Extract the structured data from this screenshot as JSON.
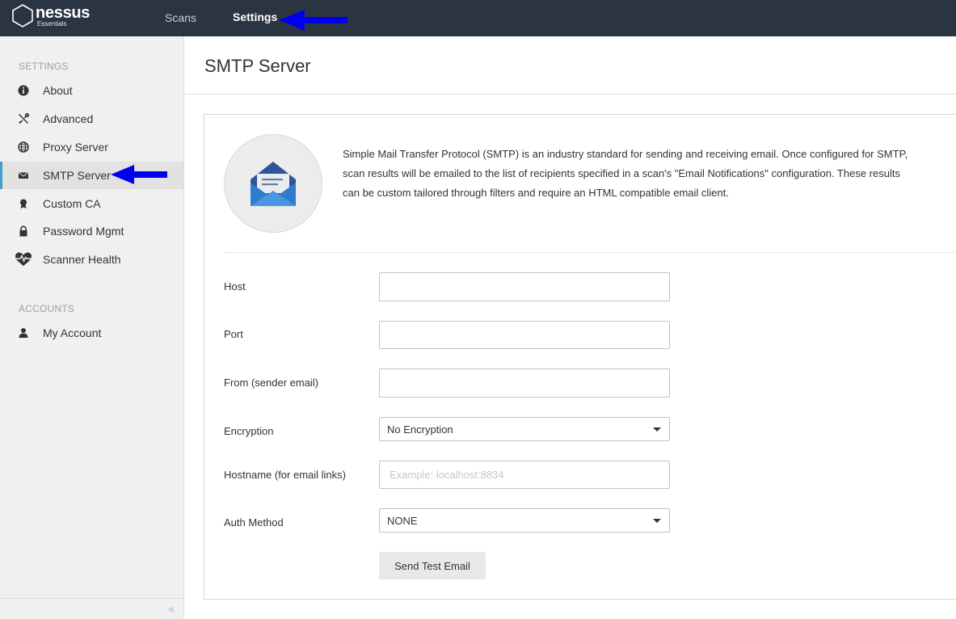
{
  "app": {
    "logo_name": "nessus",
    "logo_sub": "Essentials"
  },
  "topnav": {
    "items": [
      {
        "label": "Scans",
        "active": false
      },
      {
        "label": "Settings",
        "active": true
      }
    ]
  },
  "sidebar": {
    "settings_header": "SETTINGS",
    "settings_items": [
      {
        "label": "About",
        "icon": "info-icon"
      },
      {
        "label": "Advanced",
        "icon": "tools-icon"
      },
      {
        "label": "Proxy Server",
        "icon": "globe-icon"
      },
      {
        "label": "SMTP Server",
        "icon": "envelope-icon",
        "active": true
      },
      {
        "label": "Custom CA",
        "icon": "certificate-icon"
      },
      {
        "label": "Password Mgmt",
        "icon": "lock-icon"
      },
      {
        "label": "Scanner Health",
        "icon": "heart-pulse-icon"
      }
    ],
    "accounts_header": "ACCOUNTS",
    "accounts_items": [
      {
        "label": "My Account",
        "icon": "user-icon"
      }
    ],
    "collapse_glyph": "«"
  },
  "main": {
    "title": "SMTP Server",
    "description": "Simple Mail Transfer Protocol (SMTP) is an industry standard for sending and receiving email. Once configured for SMTP, scan results will be emailed to the list of recipients specified in a scan's \"Email Notifications\" configuration. These results can be custom tailored through filters and require an HTML compatible email client.",
    "form": {
      "host": {
        "label": "Host",
        "value": "",
        "placeholder": ""
      },
      "port": {
        "label": "Port",
        "value": "",
        "placeholder": ""
      },
      "from": {
        "label": "From (sender email)",
        "value": "",
        "placeholder": ""
      },
      "encryption": {
        "label": "Encryption",
        "value": "No Encryption"
      },
      "hostname": {
        "label": "Hostname (for email links)",
        "value": "",
        "placeholder": "Example: localhost:8834"
      },
      "auth_method": {
        "label": "Auth Method",
        "value": "NONE"
      }
    },
    "test_button": "Send Test Email"
  },
  "colors": {
    "topbar": "#2b3542",
    "sidebar": "#f0f0f0",
    "active_accent": "#3ea1d0",
    "annotation_arrow": "#0000ee",
    "mail_icon": "#2f7ccf"
  }
}
